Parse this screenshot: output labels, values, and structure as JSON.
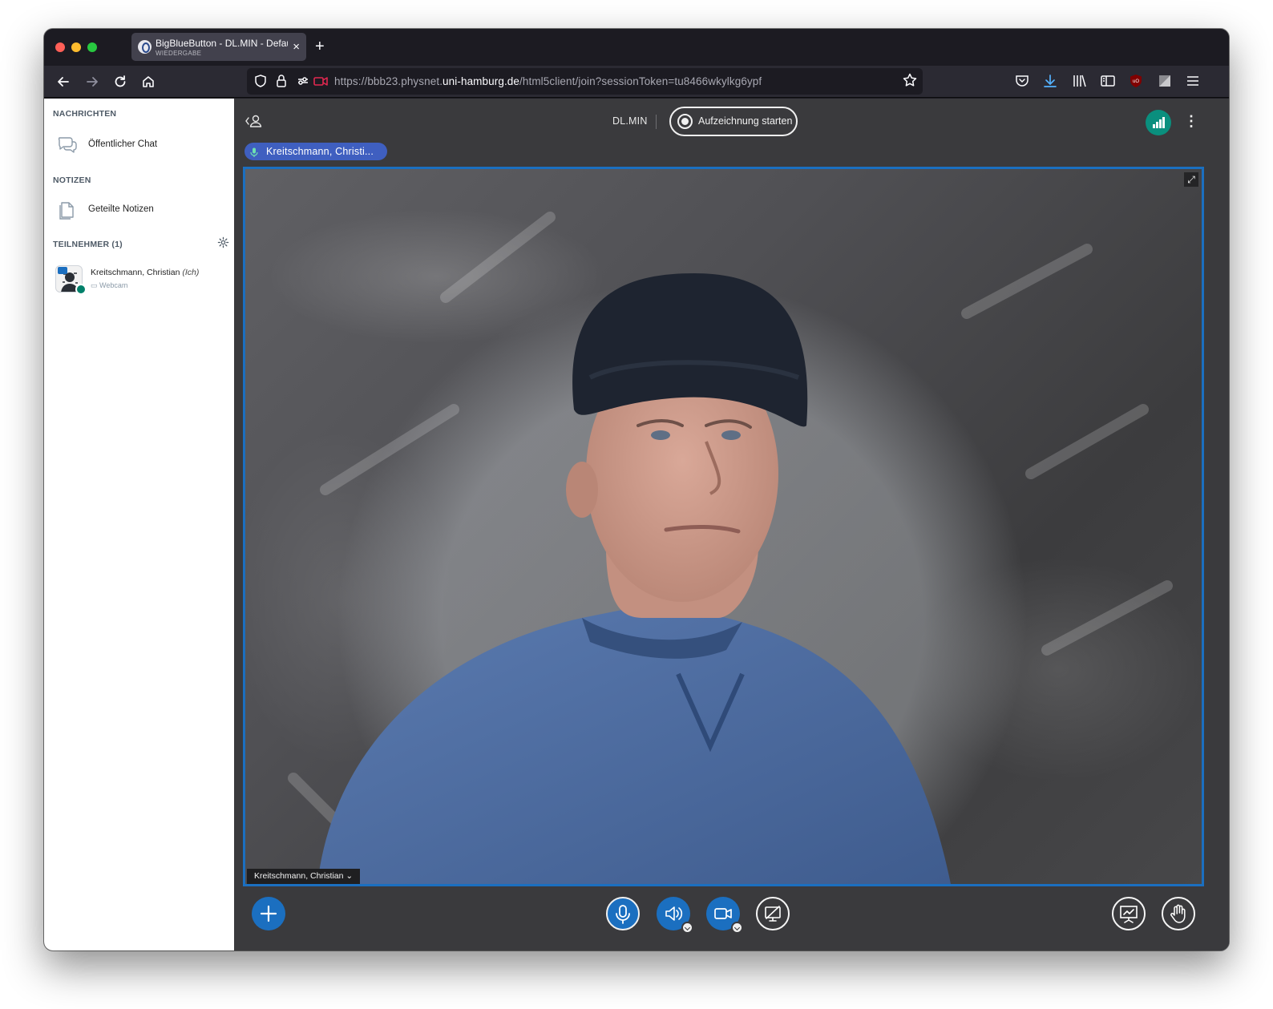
{
  "browser": {
    "tab": {
      "title": "BigBlueButton - DL.MIN - Default",
      "subtitle": "WIEDERGABE",
      "close": "×"
    },
    "new_tab": "+",
    "url": {
      "prefix": "https://bbb23.physnet.",
      "host": "uni-hamburg.de",
      "path": "/html5client/join?sessionToken=tu8466wkylkg6ypf"
    }
  },
  "sidebar": {
    "messages_header": "NACHRICHTEN",
    "public_chat": "Öffentlicher Chat",
    "notes_header": "NOTIZEN",
    "shared_notes": "Geteilte Notizen",
    "participants_header": "TEILNEHMER (1)",
    "user": {
      "name": "Kreitschmann, Christian",
      "self_tag": "(Ich)",
      "status": "Webcam"
    }
  },
  "meeting": {
    "name": "DL.MIN",
    "record_label": "Aufzeichnung starten",
    "talker": "Kreitschmann, Christi...",
    "video_label": "Kreitschmann, Christian ⌄"
  },
  "colors": {
    "accent_blue": "#1b6fc0",
    "talker_pill": "#3f5fc0",
    "connection_green": "#0a8f7e",
    "main_background": "#3a3a3d"
  },
  "icons": {
    "back": "back-arrow-icon",
    "forward": "forward-arrow-icon",
    "reload": "reload-icon",
    "home": "home-icon",
    "shield": "tracking-shield-icon",
    "lock": "lock-icon",
    "permissions": "permissions-icon",
    "camera_sharing": "camera-sharing-icon",
    "bookmark": "star-icon",
    "pocket": "pocket-icon",
    "downloads": "download-icon",
    "library": "library-icon",
    "sidebar": "sidebar-icon",
    "ublock": "ublock-icon",
    "extension": "extension-icon",
    "menu": "hamburger-menu-icon",
    "chat": "chat-icon",
    "notes": "notes-icon",
    "settings": "gear-icon",
    "users_toggle": "user-list-toggle-icon",
    "record": "record-icon",
    "connection": "connection-status-icon",
    "more": "more-options-icon",
    "fullscreen": "fullscreen-icon",
    "actions": "plus-icon",
    "mic": "microphone-icon",
    "audio": "speaker-icon",
    "video": "video-camera-icon",
    "screenshare": "screen-share-icon",
    "presentation": "presentation-icon",
    "raise_hand": "hand-icon"
  }
}
